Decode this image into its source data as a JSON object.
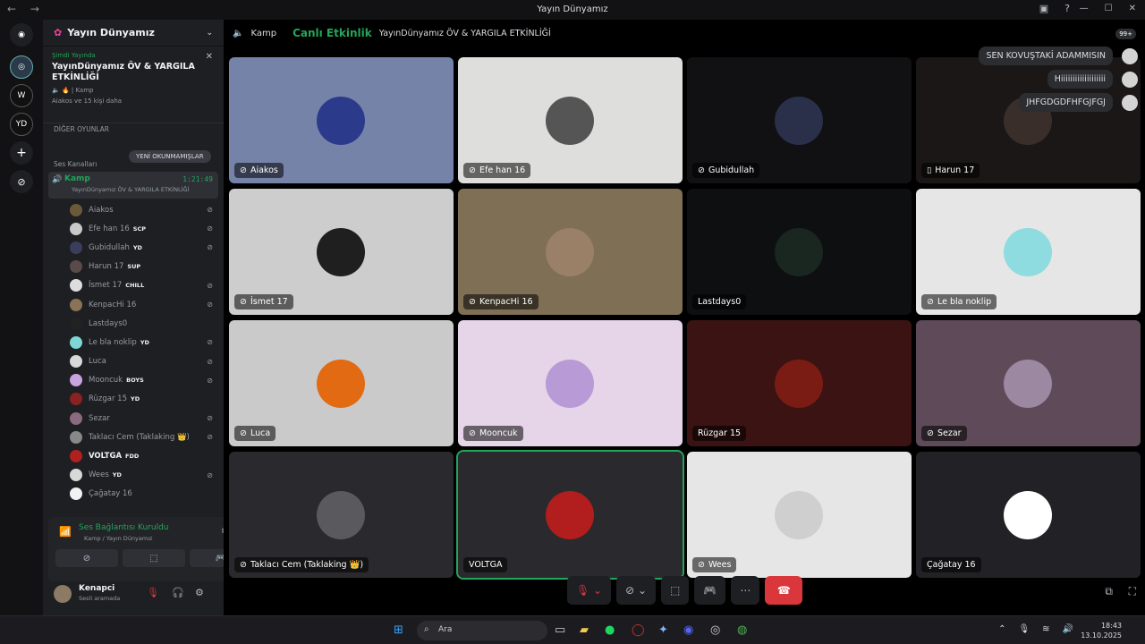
{
  "window": {
    "title": "Yayın Dünyamız",
    "nav": "← →"
  },
  "sidebar": {
    "server_name": "Yayın Dünyamız",
    "live": {
      "now": "Şimdi Yayında",
      "event": "YayınDünyamız ÖV & YARGILA ETKİNLİĞİ",
      "channel": "Kamp",
      "meta": "Aiakos ve 15 kişi daha"
    },
    "unread_pill": "YENİ OKUNMAMIŞLAR",
    "category_voice": "Ses Kanalları",
    "category_other": "DİĞER OYUNLAR",
    "voice_channel": {
      "name": "Kamp",
      "time": "1:21:49",
      "sub": "YayınDünyamız ÖV & YARGILA ETKİNLİĞİ"
    },
    "members": [
      {
        "name": "Aiakos",
        "tag": "",
        "color": "#6b5a3a",
        "muted": true,
        "bold": false
      },
      {
        "name": "Efe han 16",
        "tag": "SCP",
        "color": "#c9c9c9",
        "muted": true,
        "bold": false
      },
      {
        "name": "Gubidullah",
        "tag": "YD",
        "color": "#3a3d5c",
        "muted": true,
        "bold": false
      },
      {
        "name": "Harun 17",
        "tag": "SUP",
        "color": "#5a4a4a",
        "muted": false,
        "bold": false
      },
      {
        "name": "İsmet 17",
        "tag": "CHILL",
        "color": "#dddddd",
        "muted": true,
        "bold": false
      },
      {
        "name": "KenpacHi 16",
        "tag": "",
        "color": "#8b7358",
        "muted": true,
        "bold": false
      },
      {
        "name": "Lastdays0",
        "tag": "",
        "color": "#222",
        "muted": false,
        "bold": false
      },
      {
        "name": "Le bla noklip",
        "tag": "YD",
        "color": "#7fd6d6",
        "muted": true,
        "bold": false
      },
      {
        "name": "Luca",
        "tag": "",
        "color": "#d8d8d8",
        "muted": true,
        "bold": false
      },
      {
        "name": "Mooncuk",
        "tag": "BOYS",
        "color": "#c7a4e0",
        "muted": true,
        "bold": false
      },
      {
        "name": "Rüzgar 15",
        "tag": "YD",
        "color": "#8a2222",
        "muted": false,
        "bold": false
      },
      {
        "name": "Sezar",
        "tag": "",
        "color": "#8a6a80",
        "muted": true,
        "bold": false
      },
      {
        "name": "Taklacı Cem (Taklaking 👑)",
        "tag": "",
        "color": "#888",
        "muted": true,
        "bold": false
      },
      {
        "name": "VOLTGA",
        "tag": "FDD",
        "color": "#b02020",
        "muted": false,
        "bold": true
      },
      {
        "name": "Wees",
        "tag": "YD",
        "color": "#d8d8d8",
        "muted": true,
        "bold": false
      },
      {
        "name": "Çağatay 16",
        "tag": "",
        "color": "#f2f2f2",
        "muted": false,
        "bold": false
      }
    ],
    "voice_status": {
      "title": "Ses Bağlantısı Kuruldu",
      "channel": "Kamp / Yayın Dünyamız"
    },
    "user": {
      "name": "Kenapci",
      "status": "Sesli aramada"
    }
  },
  "main": {
    "channel": "Kamp",
    "live_label": "Canlı Etkinlik",
    "event": "YayınDünyamız ÖV & YARGILA ETKİNLİĞİ",
    "badge": "99+",
    "bubbles": [
      "SEN KOVUŞTAKİ ADAMMISIN",
      "Hiiiiiiiiiiiiiiiiiii",
      "JHFGDGDFHFGJFGJ"
    ],
    "tiles": [
      {
        "name": "Aiakos",
        "bg": "#7683a8",
        "av": "#2b3a8a",
        "icon": "🔇"
      },
      {
        "name": "Efe han 16",
        "bg": "#dedfdc",
        "av": "#555",
        "icon": "🔇"
      },
      {
        "name": "Gubidullah",
        "bg": "#111114",
        "av": "#2a2f4a",
        "icon": "🔇"
      },
      {
        "name": "Harun 17",
        "bg": "#1a1716",
        "av": "#3a2e2a",
        "icon": "📱"
      },
      {
        "name": "İsmet 17",
        "bg": "#cdcdcd",
        "av": "#1f1f1f",
        "icon": "🔇"
      },
      {
        "name": "KenpacHi 16",
        "bg": "#7e6f55",
        "av": "#9a8066",
        "icon": "🔇"
      },
      {
        "name": "Lastdays0",
        "bg": "#0e0f11",
        "av": "#1a2620",
        "icon": ""
      },
      {
        "name": "Le bla noklip",
        "bg": "#e6e6e6",
        "av": "#8edbe0",
        "icon": "🔇"
      },
      {
        "name": "Luca",
        "bg": "#cacaca",
        "av": "#e26a12",
        "icon": "🔇"
      },
      {
        "name": "Mooncuk",
        "bg": "#e6d5e8",
        "av": "#b89ad6",
        "icon": "🔇"
      },
      {
        "name": "Rüzgar 15",
        "bg": "#3b1313",
        "av": "#7a1c14",
        "icon": ""
      },
      {
        "name": "Sezar",
        "bg": "#5e4a58",
        "av": "#9c88a0",
        "icon": "🔇"
      },
      {
        "name": "Taklacı Cem (Taklaking 👑)",
        "bg": "#2a2a2e",
        "av": "#5a5a5e",
        "icon": "🔇"
      },
      {
        "name": "VOLTGA",
        "bg": "#2a2a2e",
        "av": "#b21d1d",
        "icon": ""
      },
      {
        "name": "Wees",
        "bg": "#e6e6e6",
        "av": "#cfcfcf",
        "icon": "🔇"
      },
      {
        "name": "Çağatay 16",
        "bg": "#222226",
        "av": "#ffffff",
        "icon": ""
      }
    ]
  },
  "taskbar": {
    "search": "Ara",
    "time": "18:43",
    "date": "13.10.2025"
  }
}
